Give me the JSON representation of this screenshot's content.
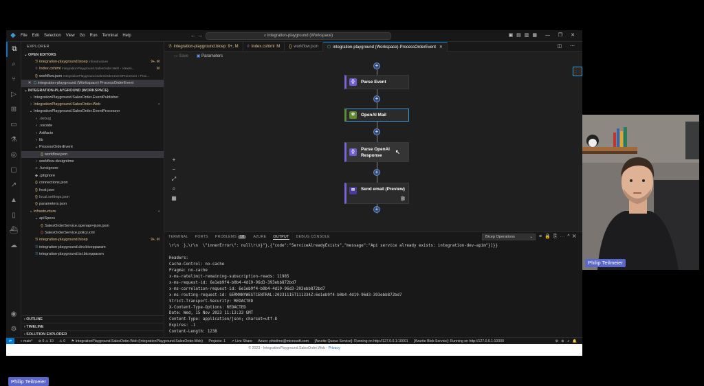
{
  "titlebar": {
    "menus": [
      "File",
      "Edit",
      "Selection",
      "View",
      "Go",
      "Run",
      "Terminal",
      "Help"
    ],
    "command_center": "integration-playground (Workspace)"
  },
  "sidebar": {
    "title": "EXPLORER",
    "open_editors_title": "OPEN EDITORS",
    "open_editors": [
      {
        "name": "integration-playground.bicep",
        "sub": "infrastructure",
        "badge": "9+, M"
      },
      {
        "name": "Index.cshtml",
        "sub": "IntegrationPlayground.SalesOrder.Web › Views\\...",
        "badge": "M"
      },
      {
        "name": "workflow.json",
        "sub": "IntegrationPlayground.SalesOrder.EventProcessor › Proc...",
        "badge": ""
      },
      {
        "name": "integration-playground (Workspace) ProcessOrderEvent",
        "sub": "",
        "badge": ""
      }
    ],
    "workspace_title": "INTEGRATION-PLAYGROUND (WORKSPACE)",
    "tree": [
      {
        "name": "IntegrationPlayground.SalesOrder.EventPublisher",
        "badge": ""
      },
      {
        "name": "IntegrationPlayground.SalesOrder.Web",
        "badge": "•"
      },
      {
        "name": "IntegrationPlayground.SalesOrder.EventProcessor",
        "badge": ""
      },
      {
        "name": ".debug",
        "badge": ""
      },
      {
        "name": ".vscode",
        "badge": ""
      },
      {
        "name": "Artifacts",
        "badge": ""
      },
      {
        "name": "lib",
        "badge": ""
      },
      {
        "name": "ProcessOrderEvent",
        "badge": ""
      },
      {
        "name": "workflow.json",
        "badge": ""
      },
      {
        "name": "workflow-designtime",
        "badge": ""
      },
      {
        "name": ".funcignore",
        "badge": ""
      },
      {
        "name": ".gitignore",
        "badge": ""
      },
      {
        "name": "connections.json",
        "badge": ""
      },
      {
        "name": "host.json",
        "badge": ""
      },
      {
        "name": "local.settings.json",
        "badge": ""
      },
      {
        "name": "parameters.json",
        "badge": ""
      },
      {
        "name": "infrastructure",
        "badge": "•"
      },
      {
        "name": "apiSpecs",
        "badge": ""
      },
      {
        "name": "SalesOrderService.openapi+json.json",
        "badge": ""
      },
      {
        "name": "SalesOrderService.policy.xml",
        "badge": ""
      },
      {
        "name": "integration-playground.bicep",
        "badge": "9+, M"
      },
      {
        "name": "integration-playground.dev.bicepparam",
        "badge": ""
      },
      {
        "name": "integration-playground.tst.bicepparam",
        "badge": ""
      }
    ],
    "bottom_sections": [
      "OUTLINE",
      "TIMELINE",
      "SOLUTION EXPLORER"
    ]
  },
  "tabs": [
    {
      "label": "integration-playground.bicep",
      "mark": "9+, M"
    },
    {
      "label": "Index.cshtml",
      "mark": "M"
    },
    {
      "label": "workflow.json",
      "mark": ""
    },
    {
      "label": "integration-playground (Workspace)-ProcessOrderEvent",
      "mark": ""
    }
  ],
  "toolbar": {
    "save": "Save",
    "parameters": "Parameters"
  },
  "workflow": {
    "nodes": [
      "Parse Event",
      "OpenAI Mail",
      "Parse OpenAI Response",
      "Send email (Preview)"
    ]
  },
  "panel": {
    "tabs": [
      "TERMINAL",
      "PORTS",
      "PROBLEMS",
      "AZURE",
      "OUTPUT",
      "DEBUG CONSOLE"
    ],
    "problems_count": "10",
    "active_tab": "OUTPUT",
    "channel": "Bicep Operations",
    "output_lines": [
      "\\r\\n  },\\r\\n  \\\"innerError\\\": null\\r\\n}\"},{\"code\":\"ServiceAlreadyExists\",\"message\":\"Api service already exists: integration-dev-apim\"}]}}",
      "",
      "Headers:",
      "Cache-Control: no-cache",
      "Pragma: no-cache",
      "x-ms-ratelimit-remaining-subscription-reads: 11985",
      "x-ms-request-id: 6e1eb9f4-b0b4-4d19-96d3-393ebb872bd7",
      "x-ms-correlation-request-id: 6e1eb9f4-b0b4-4d19-96d3-393ebb872bd7",
      "x-ms-routing-request-id: GERMANYWESTCENTRAL:20231115T111334Z:6e1eb9f4-b0b4-4d19-96d3-393ebb872bd7",
      "Strict-Transport-Security: REDACTED",
      "X-Content-Type-Options: REDACTED",
      "Date: Wed, 15 Nov 2023 11:13:33 GMT",
      "Content-Type: application/json; charset=utf-8",
      "Expires: -1",
      "Content-Length: 1238"
    ]
  },
  "statusbar": {
    "branch": "main*",
    "counts": "⊘ 0 ⚠ 10",
    "errors": "⚠ 0",
    "project": "IntegrationPlayground.SalesOrder.Web (IntegrationPlayground.SalesOrder.Web)",
    "projects": "Projects: 1",
    "liveshare": "Live Share",
    "azure": "Azure: phteilme@microsoft.com",
    "queue": "[Azurite Queue Service]: Running on http://127.0.0.1:10001",
    "blob": "[Azurite Blob Service]: Running on http://127.0.0.1:10000"
  },
  "footer": {
    "copyright": "© 2023 - IntegrationPlayground.SalesOrder.Web - ",
    "privacy": "Privacy"
  },
  "participant": {
    "name": "Philip Teilmeier"
  },
  "colors": {
    "accent": "#0078d4",
    "badge": "#5a66c9",
    "modified": "#e2c08d"
  }
}
